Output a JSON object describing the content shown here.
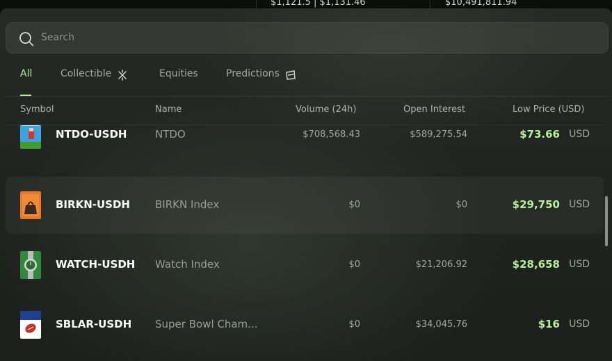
{
  "top_strip": {
    "left_text": "$1,121.5 | $1,131.46",
    "right_text": "$10,491,811.94"
  },
  "search": {
    "placeholder": "Search",
    "icon": "search-icon"
  },
  "tabs": [
    {
      "label": "All",
      "active": true
    },
    {
      "label": "Collectible",
      "icon": "sparkle-icon"
    },
    {
      "label": "Equities"
    },
    {
      "label": "Predictions",
      "icon": "ticket-icon"
    }
  ],
  "columns": {
    "symbol": "Symbol",
    "name": "Name",
    "volume": "Volume (24h)",
    "open_interest": "Open Interest",
    "low_price": "Low Price (USD)"
  },
  "rows": [
    {
      "symbol": "NTDO-USDH",
      "name": "NTDO",
      "volume": "$708,568.43",
      "open_interest": "$589,275.54",
      "low_price": "$73.66",
      "currency": "USD",
      "thumb": "nintendo-thumb-icon"
    },
    {
      "symbol": "BIRKN-USDH",
      "name": "BIRKN Index",
      "volume": "$0",
      "open_interest": "$0",
      "low_price": "$29,750",
      "currency": "USD",
      "thumb": "handbag-thumb-icon"
    },
    {
      "symbol": "WATCH-USDH",
      "name": "Watch Index",
      "volume": "$0",
      "open_interest": "$21,206.92",
      "low_price": "$28,658",
      "currency": "USD",
      "thumb": "watch-thumb-icon"
    },
    {
      "symbol": "SBLAR-USDH",
      "name": "Super Bowl Cham...",
      "volume": "$0",
      "open_interest": "$34,045.76",
      "low_price": "$16",
      "currency": "USD",
      "thumb": "football-thumb-icon"
    }
  ],
  "colors": {
    "accent": "#b5f29a",
    "panel": "#232723",
    "muted": "#a4a8a3"
  }
}
